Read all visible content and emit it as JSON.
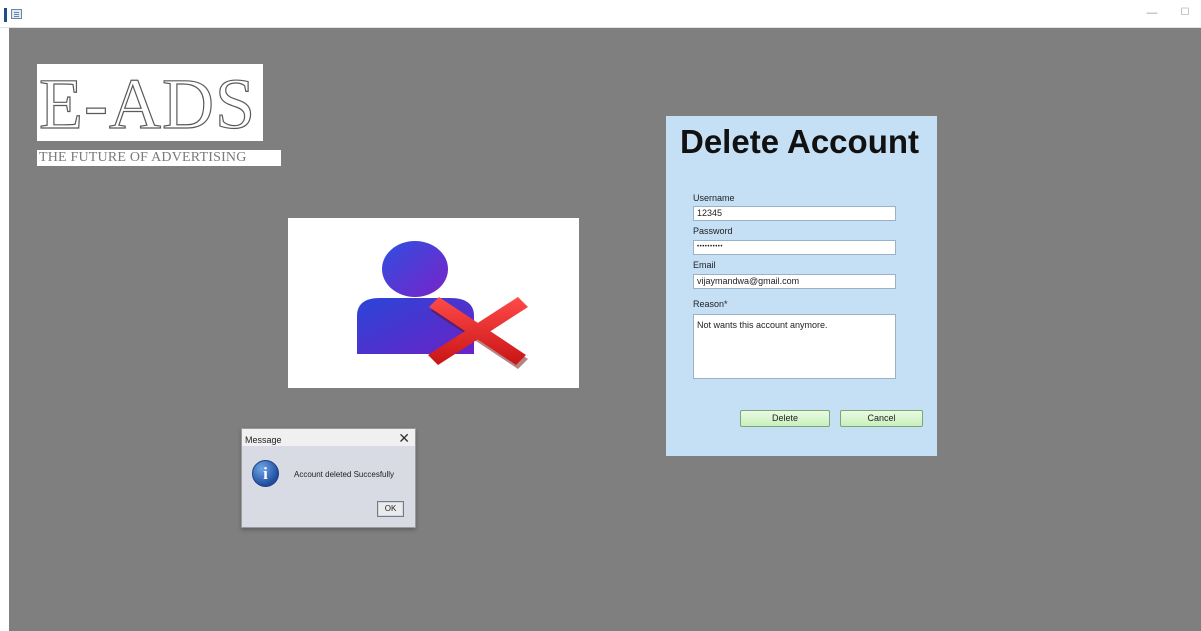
{
  "window": {
    "minimize_glyph": "—",
    "maximize_glyph": "☐"
  },
  "logo": {
    "title": "E-ADS",
    "tagline": "THE FUTURE OF ADVERTISING"
  },
  "image": {
    "icon": "delete-user-icon"
  },
  "form": {
    "heading": "Delete Account",
    "username_label": "Username",
    "username_value": "12345",
    "password_label": "Password",
    "password_value": "••••••••••",
    "email_label": "Email",
    "email_value": "vijaymandwa@gmail.com",
    "reason_label": "Reason*",
    "reason_value": "Not wants this account anymore.",
    "delete_label": "Delete",
    "cancel_label": "Cancel"
  },
  "dialog": {
    "title": "Message",
    "close_glyph": "✕",
    "message": "Account deleted Succesfully",
    "ok_label": "OK",
    "icon": "info-icon"
  },
  "colors": {
    "background": "#7f7f7f",
    "panel": "#c5dff4",
    "button": "#d6f5cc",
    "user_icon": "#4a2fd6",
    "cross": "#e52a2a"
  }
}
